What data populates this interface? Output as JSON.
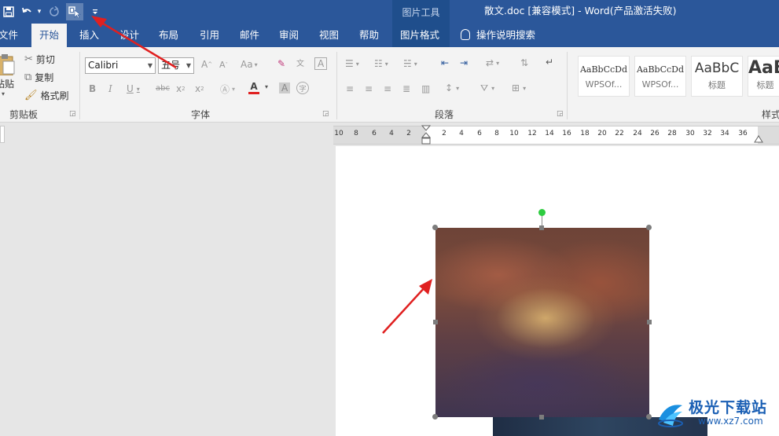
{
  "titlebar": {
    "context_group": "图片工具",
    "doc_title": "散文.doc [兼容模式]  -  Word(产品激活失败)",
    "qat": [
      {
        "name": "save-icon",
        "glyph": "🖫"
      },
      {
        "name": "undo-icon",
        "glyph": "↶"
      },
      {
        "name": "undo-dropdown-icon",
        "glyph": "▾"
      },
      {
        "name": "redo-icon",
        "glyph": "↻"
      },
      {
        "name": "select-objects-icon",
        "glyph": "⬚"
      },
      {
        "name": "customize-qat-icon",
        "glyph": "≡"
      }
    ]
  },
  "tabs": {
    "file": "文件",
    "home": "开始",
    "insert": "插入",
    "design": "设计",
    "layout": "布局",
    "references": "引用",
    "mailings": "邮件",
    "review": "审阅",
    "view": "视图",
    "help": "帮助",
    "picture_format": "图片格式",
    "tell_me": "操作说明搜索"
  },
  "ribbon": {
    "clipboard": {
      "paste": "粘贴",
      "cut": "剪切",
      "copy": "复制",
      "format_painter": "格式刷",
      "label": "剪贴板"
    },
    "font": {
      "font_name": "Calibri",
      "font_size": "五号",
      "label": "字体"
    },
    "paragraph": {
      "label": "段落"
    },
    "styles": {
      "label": "样式",
      "items": [
        {
          "preview": "AaBbCcDd",
          "name": "WPSOf..."
        },
        {
          "preview": "AaBbCcDd",
          "name": "WPSOf..."
        },
        {
          "preview": "AaBbC",
          "name": "标题"
        },
        {
          "preview": "AaB",
          "name": "标题"
        }
      ]
    }
  },
  "ruler": {
    "ticks": [
      "10",
      "8",
      "6",
      "4",
      "2",
      "2",
      "4",
      "6",
      "8",
      "10",
      "12",
      "14",
      "16",
      "18",
      "20",
      "22",
      "24",
      "26",
      "28",
      "30",
      "32",
      "34",
      "36"
    ]
  },
  "watermark": {
    "brand": "极光下载站",
    "url": "www.xz7.com"
  },
  "colors": {
    "titlebar": "#2b579a",
    "context_tab": "#1f4e8c",
    "annotation_arrow": "#e02020",
    "font_color_bar": "#e02020"
  }
}
